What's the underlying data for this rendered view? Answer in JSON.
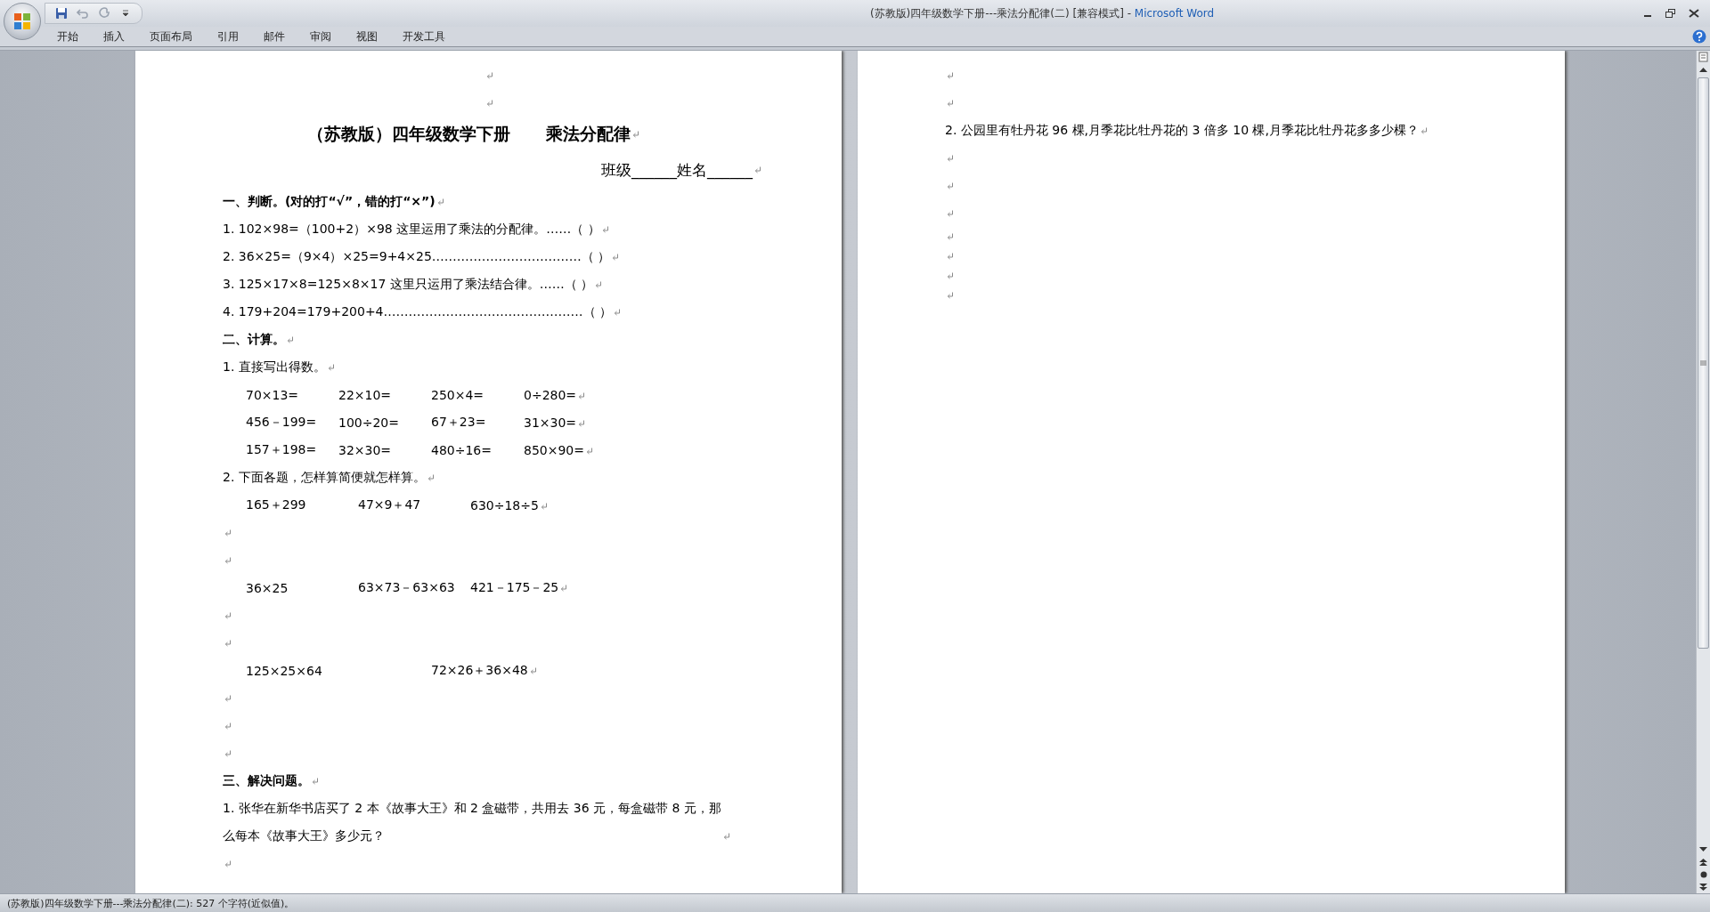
{
  "window": {
    "document_title": "(苏教版)四年级数学下册---乘法分配律(二) [兼容模式]",
    "separator": " - ",
    "app_name": "Microsoft Word"
  },
  "ribbon_tabs": [
    {
      "label": "开始",
      "selected": false
    },
    {
      "label": "插入",
      "selected": false
    },
    {
      "label": "页面布局",
      "selected": false
    },
    {
      "label": "引用",
      "selected": false
    },
    {
      "label": "邮件",
      "selected": false
    },
    {
      "label": "审阅",
      "selected": false
    },
    {
      "label": "视图",
      "selected": false
    },
    {
      "label": "开发工具",
      "selected": false
    }
  ],
  "pages": [
    {
      "paragraphs": [
        {
          "kind": "blank_center"
        },
        {
          "kind": "blank_center"
        },
        {
          "kind": "title",
          "parts": [
            "（苏教版）四年级数学下册",
            "乘法分配律"
          ]
        },
        {
          "kind": "right",
          "text": "班级______姓名______"
        },
        {
          "kind": "heading",
          "text": "一、判断。(对的打“√”，错的打“×”)"
        },
        {
          "kind": "item",
          "text": "1.  102×98=（100+2）×98 这里运用了乘法的分配律。……（    ）"
        },
        {
          "kind": "item",
          "text": "2.  36×25=（9×4）×25=9+4×25………………………………（    ）"
        },
        {
          "kind": "item",
          "text": "3.  125×17×8=125×8×17 这里只运用了乘法结合律。……（  ）"
        },
        {
          "kind": "item",
          "text": "4.  179+204=179+200+4…………………………………………（    ）"
        },
        {
          "kind": "heading",
          "text": "二、计算。"
        },
        {
          "kind": "item",
          "text": "1.  直接写出得数。"
        },
        {
          "kind": "row",
          "cells": [
            "70×13=",
            "22×10=",
            "250×4=",
            "0÷280="
          ]
        },
        {
          "kind": "row",
          "cells": [
            "456－199=",
            "100÷20=",
            "67＋23=",
            "31×30="
          ]
        },
        {
          "kind": "row",
          "cells": [
            "157＋198=",
            "32×30=",
            "480÷16=",
            "850×90="
          ]
        },
        {
          "kind": "item",
          "text": "2.  下面各题，怎样算简便就怎样算。"
        },
        {
          "kind": "row",
          "cells": [
            "165＋299",
            "47×9＋47",
            "630÷18÷5"
          ]
        },
        {
          "kind": "blank"
        },
        {
          "kind": "blank"
        },
        {
          "kind": "row",
          "cells": [
            "36×25",
            "63×73－63×63",
            "421－175－25"
          ]
        },
        {
          "kind": "blank"
        },
        {
          "kind": "blank"
        },
        {
          "kind": "row",
          "cells": [
            "125×25×64",
            "72×26＋36×48"
          ]
        },
        {
          "kind": "blank"
        },
        {
          "kind": "blank"
        },
        {
          "kind": "blank"
        },
        {
          "kind": "heading",
          "text": "三、解决问题。"
        },
        {
          "kind": "item",
          "text": "1.  张华在新华书店买了 2 本《故事大王》和 2 盒磁带，共用去 36 元，每盒磁带 8 元，那么每本《故事大王》多少元？"
        },
        {
          "kind": "blank"
        }
      ]
    },
    {
      "paragraphs": [
        {
          "kind": "blank"
        },
        {
          "kind": "blank"
        },
        {
          "kind": "item",
          "text": "2.  公园里有牡丹花 96 棵,月季花比牡丹花的 3 倍多 10 棵,月季花比牡丹花多多少棵？"
        },
        {
          "kind": "blank"
        },
        {
          "kind": "blank"
        },
        {
          "kind": "blank"
        },
        {
          "kind": "blank_small"
        },
        {
          "kind": "blank_small"
        },
        {
          "kind": "blank_small"
        },
        {
          "kind": "blank_small"
        }
      ]
    }
  ],
  "status_bar": {
    "text": "(苏教版)四年级数学下册---乘法分配律(二): 527 个字符(近似值)。"
  }
}
